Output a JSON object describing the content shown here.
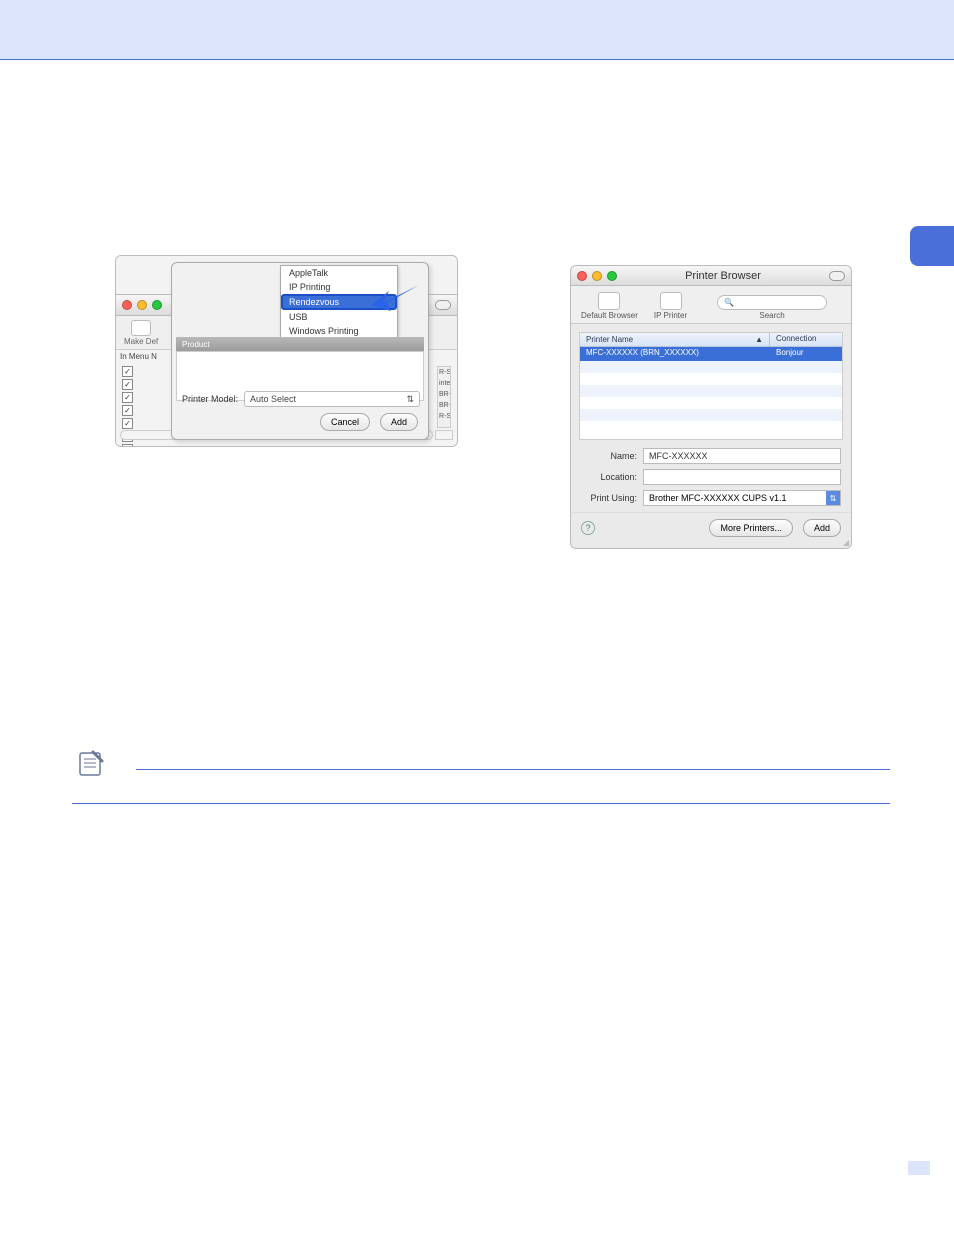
{
  "screenshotA": {
    "menu": {
      "items": [
        "AppleTalk",
        "IP Printing",
        "Rendezvous",
        "USB",
        "Windows Printing"
      ],
      "highlighted": "Rendezvous"
    },
    "backWindow": {
      "toolbar": {
        "makeDefault": "Make Def"
      },
      "columns": "In Menu   N",
      "scrollLabels": [
        "R-Script",
        "inter",
        "BR-Scri",
        "BR-Scri",
        "R-Script"
      ]
    },
    "innerWindow": {
      "listHeader": "Product",
      "printerModelLabel": "Printer Model:",
      "printerModelValue": "Auto Select",
      "buttons": {
        "cancel": "Cancel",
        "add": "Add"
      }
    }
  },
  "screenshotB": {
    "title": "Printer Browser",
    "toolbar": {
      "defaultBrowser": "Default Browser",
      "ipPrinter": "IP Printer",
      "searchLabel": "Search",
      "searchPlaceholder": "Q"
    },
    "list": {
      "headers": {
        "name": "Printer Name",
        "connection": "Connection"
      },
      "rows": [
        {
          "name": "MFC-XXXXXX (BRN_XXXXXX)",
          "connection": "Bonjour",
          "selected": true
        }
      ]
    },
    "form": {
      "nameLabel": "Name:",
      "nameValue": "MFC-XXXXXX",
      "locationLabel": "Location:",
      "locationValue": "",
      "printUsingLabel": "Print Using:",
      "printUsingValue": "Brother MFC-XXXXXX CUPS v1.1"
    },
    "footer": {
      "help": "?",
      "morePrinters": "More Printers...",
      "add": "Add"
    }
  }
}
